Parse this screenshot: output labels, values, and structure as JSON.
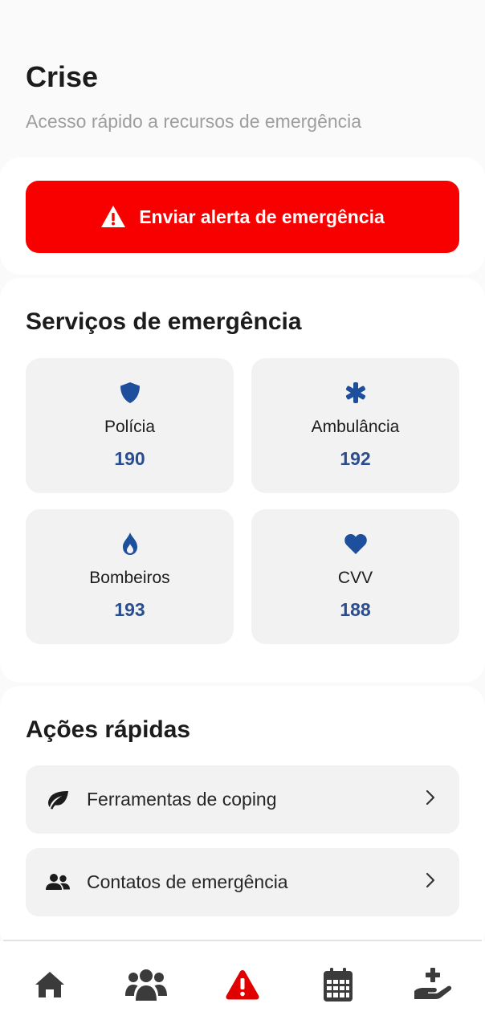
{
  "header": {
    "title": "Crise",
    "subtitle": "Acesso rápido a recursos de emergência"
  },
  "alert": {
    "label": "Enviar alerta de emergência",
    "icon": "warning-triangle-icon",
    "color": "#f90000"
  },
  "services": {
    "title": "Serviços de emergência",
    "items": [
      {
        "name": "Polícia",
        "number": "190",
        "icon": "shield-icon"
      },
      {
        "name": "Ambulância",
        "number": "192",
        "icon": "asterisk-icon"
      },
      {
        "name": "Bombeiros",
        "number": "193",
        "icon": "flame-icon"
      },
      {
        "name": "CVV",
        "number": "188",
        "icon": "heart-icon"
      }
    ],
    "accent_color": "#1e4f9c"
  },
  "actions": {
    "title": "Ações rápidas",
    "items": [
      {
        "label": "Ferramentas de coping",
        "icon": "leaf-icon"
      },
      {
        "label": "Contatos de emergência",
        "icon": "users-icon"
      }
    ]
  },
  "nav": {
    "items": [
      {
        "icon": "home-icon"
      },
      {
        "icon": "community-icon"
      },
      {
        "icon": "alert-icon",
        "active": true
      },
      {
        "icon": "calendar-icon"
      },
      {
        "icon": "hand-medical-icon"
      }
    ],
    "active_color": "#e00000",
    "inactive_color": "#3b3b3b"
  }
}
